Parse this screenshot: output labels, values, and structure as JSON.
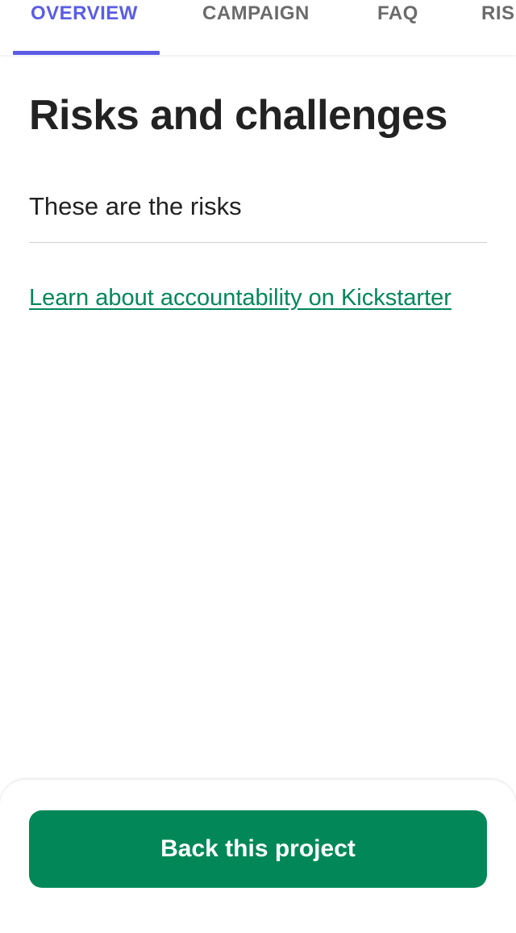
{
  "tabs": [
    {
      "label": "OVERVIEW",
      "active": true
    },
    {
      "label": "CAMPAIGN",
      "active": false
    },
    {
      "label": "FAQ",
      "active": false
    },
    {
      "label": "RIS",
      "active": false
    }
  ],
  "colors": {
    "accent": "#5b5de6",
    "brand_green": "#028858",
    "link_green": "#02875a"
  },
  "main": {
    "title": "Risks and challenges",
    "risks_text": "These are the risks",
    "accountability_link": "Learn about accountability on Kickstarter"
  },
  "footer": {
    "back_button_label": "Back this project"
  }
}
